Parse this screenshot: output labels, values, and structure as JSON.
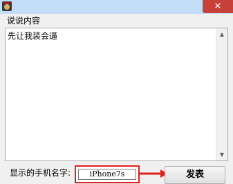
{
  "window": {
    "close_label": "✕"
  },
  "content_section": {
    "label": "说说内容",
    "text": "先让我装会逼"
  },
  "footer": {
    "phone_name_label": "显示的手机名字:",
    "phone_name_value": "iPhone7s",
    "send_label": "发表"
  },
  "icons": {
    "app": "app-icon",
    "close": "close-icon",
    "scroll_up": "scroll-up-arrow-icon",
    "scroll_down": "scroll-down-arrow-icon",
    "callout_arrow": "red-arrow-icon"
  },
  "colors": {
    "highlight": "#e02020",
    "close_button": "#c7413a",
    "titlebar": "#c5def8"
  }
}
